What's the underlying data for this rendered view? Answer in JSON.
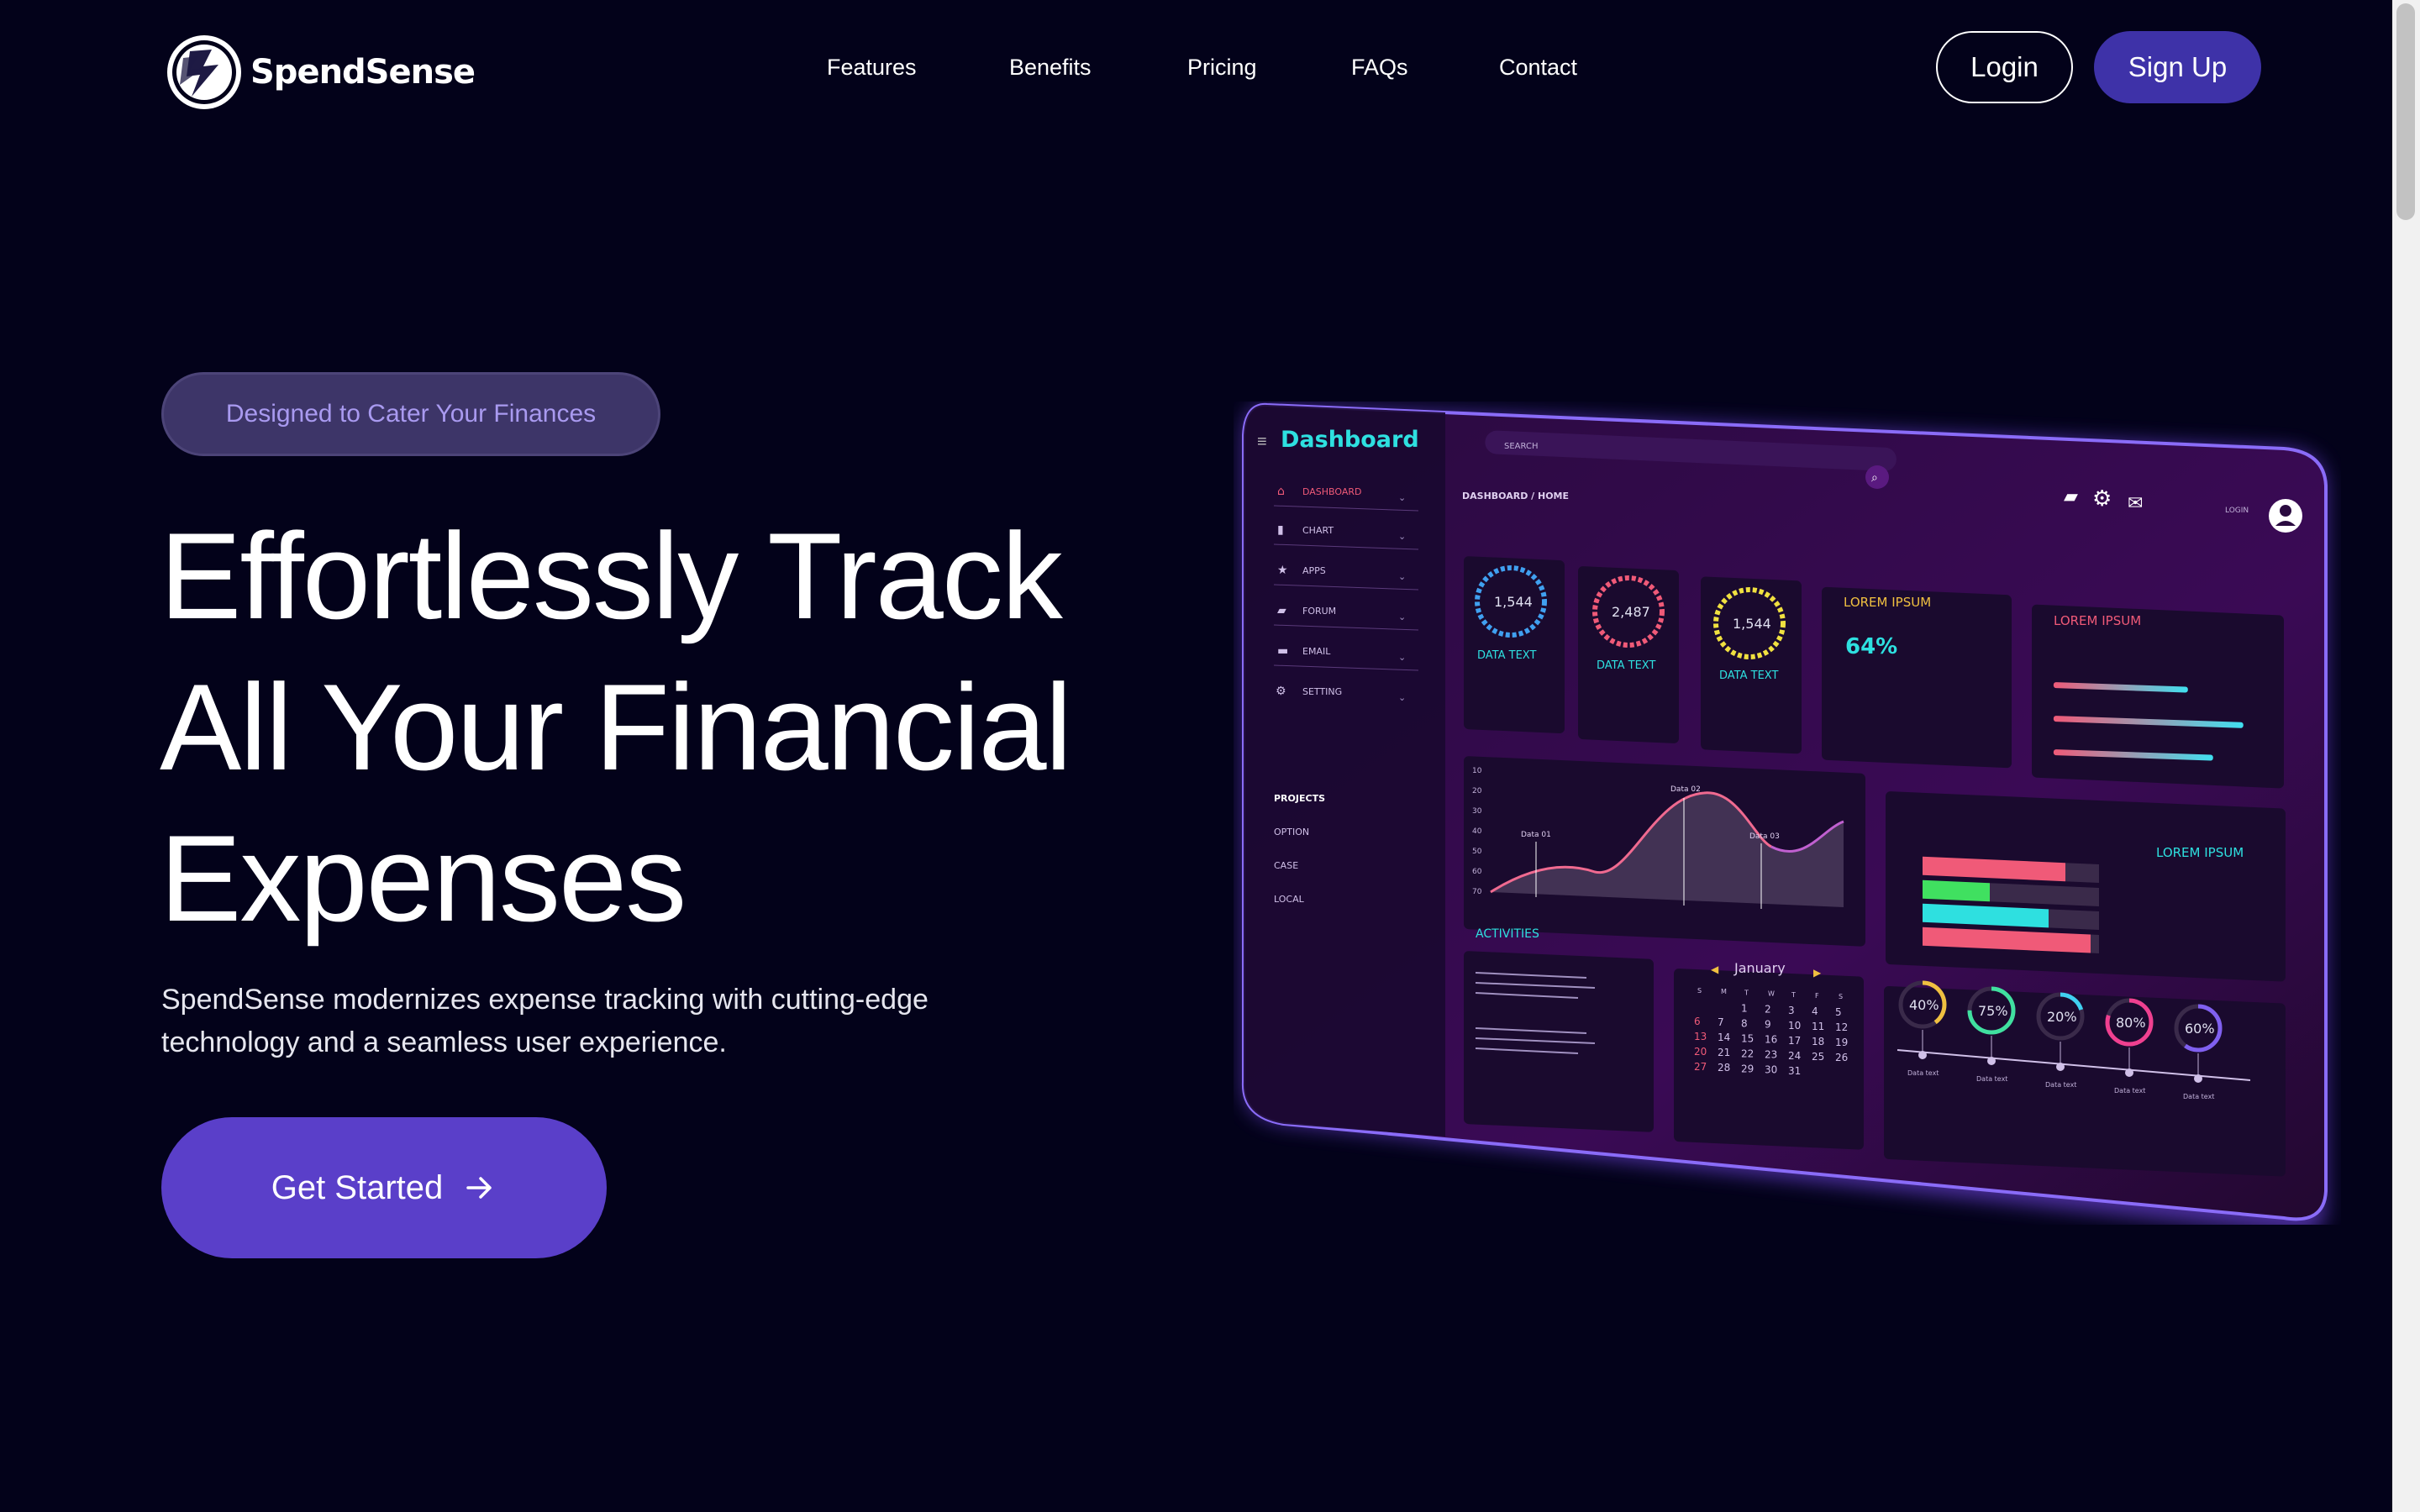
{
  "brand": {
    "name": "SpendSense"
  },
  "nav": {
    "links": [
      "Features",
      "Benefits",
      "Pricing",
      "FAQs",
      "Contact"
    ],
    "login_label": "Login",
    "signup_label": "Sign Up"
  },
  "hero": {
    "badge": "Designed to Cater Your Finances",
    "headline_lines": [
      "Effortlessly Track",
      "All Your Financial",
      "Expenses"
    ],
    "subtitle": "SpendSense modernizes expense tracking with cutting-edge technology and a seamless user experience.",
    "cta_label": "Get Started"
  },
  "dashboard_mockup": {
    "title": "Dashboard",
    "search_placeholder": "SEARCH",
    "breadcrumb": "DASHBOARD / HOME",
    "login_label": "LOGIN",
    "menu": [
      "DASHBOARD",
      "CHART",
      "APPS",
      "FORUM",
      "EMAIL",
      "SETTING"
    ],
    "projects_title": "PROJECTS",
    "projects": [
      "OPTION",
      "CASE",
      "LOCAL"
    ],
    "stat_cards": [
      {
        "value": "1,544",
        "label": "DATA TEXT"
      },
      {
        "value": "2,487",
        "label": "DATA TEXT"
      },
      {
        "value": "1,544",
        "label": "DATA TEXT"
      }
    ],
    "lorem_card_1": {
      "title": "LOREM IPSUM",
      "value": "64%"
    },
    "lorem_card_2": {
      "title": "LOREM IPSUM"
    },
    "lorem_card_3": {
      "title": "LOREM IPSUM"
    },
    "line_chart": {
      "y_ticks": [
        "10",
        "20",
        "30",
        "40",
        "50",
        "60",
        "70"
      ],
      "labels": [
        "Data 01",
        "Data 02",
        "Data 03"
      ]
    },
    "activities_title": "ACTIVITIES",
    "calendar": {
      "month": "January",
      "weekdays": [
        "S",
        "M",
        "T",
        "W",
        "T",
        "F",
        "S"
      ],
      "rows": [
        [
          "",
          "",
          "1",
          "2",
          "3",
          "4",
          "5"
        ],
        [
          "6",
          "7",
          "8",
          "9",
          "10",
          "11",
          "12"
        ],
        [
          "13",
          "14",
          "15",
          "16",
          "17",
          "18",
          "19"
        ],
        [
          "20",
          "21",
          "22",
          "23",
          "24",
          "25",
          "26"
        ],
        [
          "27",
          "28",
          "29",
          "30",
          "31",
          "",
          ""
        ]
      ]
    },
    "rings": [
      {
        "label": "40%",
        "value": 40,
        "caption": "Data text",
        "color": "#f0c040"
      },
      {
        "label": "75%",
        "value": 75,
        "caption": "Data text",
        "color": "#40e0a0"
      },
      {
        "label": "20%",
        "value": 20,
        "caption": "Data text",
        "color": "#40d0f0"
      },
      {
        "label": "80%",
        "value": 80,
        "caption": "Data text",
        "color": "#f04090"
      },
      {
        "label": "60%",
        "value": 60,
        "caption": "Data text",
        "color": "#8060f0"
      }
    ]
  },
  "colors": {
    "background": "#03021a",
    "accent": "#5a3fc9",
    "signup": "#3e32a8",
    "badge_bg": "#3d3568",
    "badge_text": "#a99af0",
    "dashboard_title": "#2ee0e0"
  }
}
